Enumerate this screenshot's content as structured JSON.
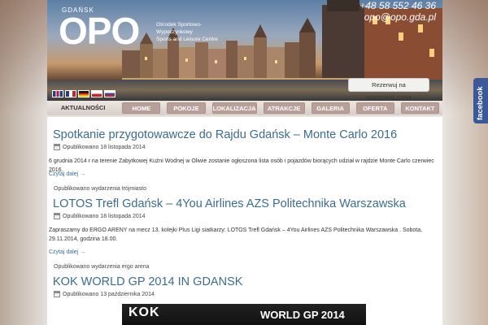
{
  "header": {
    "city_label": "GDAŃSK",
    "logo_text": "OPO",
    "logo_sub_line1": "Ośrodek Sportowo-Wypoczynkowy",
    "logo_sub_line2": "Sports and Leisure Centre",
    "phone": "+48 58 552 46 36",
    "email": "opo@opo.gda.pl",
    "booking_label": "Rezerwuj na BOOKING.COM"
  },
  "flags": [
    "en-flag",
    "fr-flag",
    "de-flag",
    "pl-flag",
    "ru-flag"
  ],
  "nav": {
    "items": [
      "AKTUALNOŚCI",
      "HOME",
      "POKOJE",
      "LOKALIZACJA",
      "ATRAKCJE",
      "GALERIA",
      "OFERTA",
      "KONTAKT"
    ]
  },
  "posts": [
    {
      "title": "Spotkanie przygotowawcze do Rajdu Gdańsk – Monte Carlo 2016",
      "date": "Opublikowano 18 listopada 2014",
      "excerpt": "6 grudnia 2014 r na terenie Zabytkowej Kuźni Wodnej w Oliwie zostanie ogłoszona lista osób i pojazdów biorących udział w rajdzie Monte Carlo czerwiec 2016.",
      "read_more": "Czytaj dalej →",
      "category": "Opublikowano wydarzenia trójmiasto"
    },
    {
      "title": "LOTOS Trefl Gdańsk – 4You Airlines AZS Politechnika Warszawska",
      "date": "Opublikowano 18 listopada 2014",
      "excerpt": "Zapraszamy do ERGO ARENY na mecz 13. kolejki Plus Ligi siatkarzy: LOTOS Trefl Gdańsk – 4You Airlines AZS Politechnika Warszawska . Sobota, 29.11.2014, godzina 18.00.",
      "read_more": "Czytaj dalej →",
      "category": "Opublikowano wydarzenia ergo arena"
    },
    {
      "title": "KOK WORLD GP 2014 IN GDANSK",
      "date": "Opublikowano 13 października 2014",
      "image_logo": "KOK",
      "image_text": "WORLD GP 2014"
    }
  ],
  "social": {
    "facebook_label": "facebook",
    "facebook_color": "#3b5998"
  },
  "colors": {
    "link": "#3b6c8e",
    "nav_pill": "#b99f99"
  }
}
